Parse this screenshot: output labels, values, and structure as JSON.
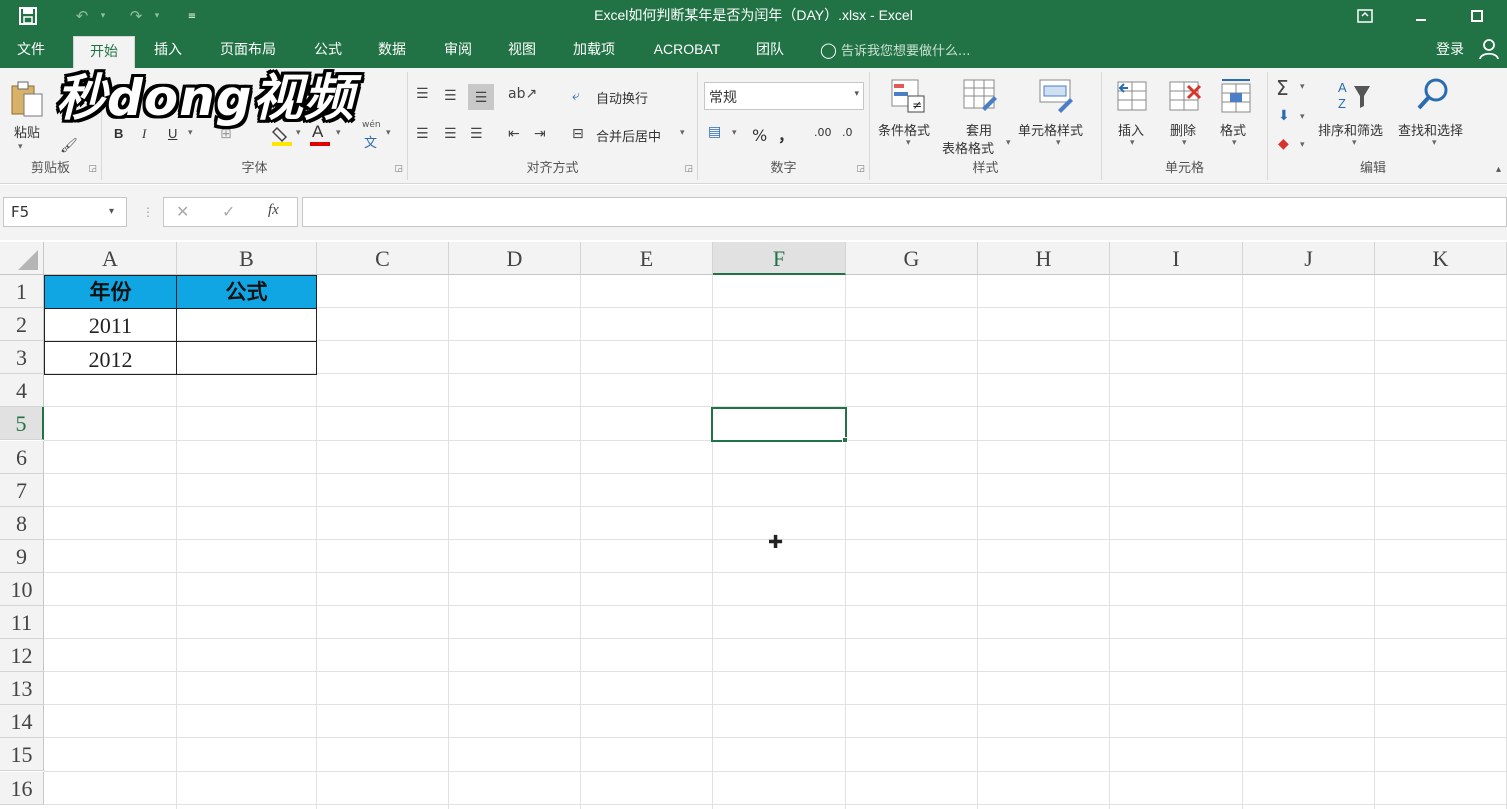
{
  "window": {
    "title": "Excel如何判断某年是否为闰年（DAY）.xlsx - Excel"
  },
  "tabs": [
    "文件",
    "开始",
    "插入",
    "页面布局",
    "公式",
    "数据",
    "审阅",
    "视图",
    "加载项",
    "ACROBAT",
    "团队"
  ],
  "active_tab": "开始",
  "tell_me": "告诉我您想要做什么...",
  "login": "登录",
  "watermark": "秒dong视频",
  "ribbon": {
    "clipboard": {
      "paste": "粘贴",
      "label": "剪贴板"
    },
    "font": {
      "bold": "B",
      "italic": "I",
      "underline": "U",
      "font_color": "A",
      "phonetic_top": "wén",
      "phonetic_bottom": "文",
      "label": "字体"
    },
    "alignment": {
      "wrap": "自动换行",
      "merge": "合并后居中",
      "label": "对齐方式"
    },
    "number": {
      "format": "常规",
      "percent": "%",
      "comma": "，",
      "inc_dec": ".00",
      "dec_dec": ".0",
      "label": "数字"
    },
    "styles": {
      "conditional": "条件格式",
      "table_top": "套用",
      "table_bottom": "表格格式",
      "cell_styles": "单元格样式",
      "label": "样式"
    },
    "cells": {
      "insert": "插入",
      "delete": "删除",
      "format": "格式",
      "label": "单元格"
    },
    "editing": {
      "sort": "排序和筛选",
      "find": "查找和选择",
      "label": "编辑"
    }
  },
  "formula_bar": {
    "name_box": "F5",
    "cancel": "✕",
    "enter": "✓",
    "fx": "fx",
    "content": ""
  },
  "columns": [
    "A",
    "B",
    "C",
    "D",
    "E",
    "F",
    "G",
    "H",
    "I",
    "J",
    "K"
  ],
  "rows": [
    "1",
    "2",
    "3",
    "4",
    "5",
    "6",
    "7",
    "8",
    "9",
    "10",
    "11",
    "12",
    "13",
    "14",
    "15",
    "16"
  ],
  "cells": {
    "A1": "年份",
    "B1": "公式",
    "A2": "2011",
    "A3": "2012"
  },
  "selected_cell": "F5",
  "colors": {
    "excel_green": "#217346",
    "header_fill": "#10a5e3"
  }
}
